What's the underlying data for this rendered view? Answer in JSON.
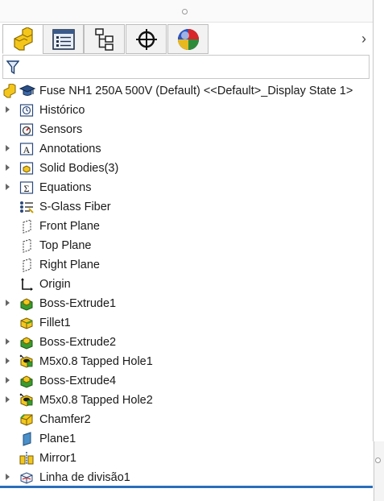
{
  "tabs": [
    {
      "name": "feature-manager",
      "icon": "part-icon",
      "active": true
    },
    {
      "name": "property-manager",
      "icon": "property-list-icon",
      "active": false
    },
    {
      "name": "configuration-manager",
      "icon": "configuration-tree-icon",
      "active": false
    },
    {
      "name": "dimxpert-manager",
      "icon": "crosshair-icon",
      "active": false
    },
    {
      "name": "display-manager",
      "icon": "appearance-sphere-icon",
      "active": false
    }
  ],
  "tab_overflow": "›",
  "filter": {
    "icon": "filter-icon"
  },
  "tree": {
    "root_label": "Fuse NH1 250A 500V (Default) <<Default>_Display State 1>",
    "items": [
      {
        "label": "Histórico",
        "icon": "history-icon",
        "expandable": true
      },
      {
        "label": "Sensors",
        "icon": "sensors-icon",
        "expandable": false
      },
      {
        "label": "Annotations",
        "icon": "annotations-icon",
        "expandable": true
      },
      {
        "label": "Solid Bodies(3)",
        "icon": "solid-bodies-icon",
        "expandable": true
      },
      {
        "label": "Equations",
        "icon": "equations-icon",
        "expandable": true
      },
      {
        "label": "S-Glass Fiber",
        "icon": "material-icon",
        "expandable": false
      },
      {
        "label": "Front Plane",
        "icon": "plane-icon",
        "expandable": false
      },
      {
        "label": "Top Plane",
        "icon": "plane-icon",
        "expandable": false
      },
      {
        "label": "Right Plane",
        "icon": "plane-icon",
        "expandable": false
      },
      {
        "label": "Origin",
        "icon": "origin-icon",
        "expandable": false
      },
      {
        "label": "Boss-Extrude1",
        "icon": "boss-extrude-icon",
        "expandable": true
      },
      {
        "label": "Fillet1",
        "icon": "fillet-icon",
        "expandable": false
      },
      {
        "label": "Boss-Extrude2",
        "icon": "boss-extrude-icon",
        "expandable": true
      },
      {
        "label": "M5x0.8 Tapped Hole1",
        "icon": "hole-wizard-icon",
        "expandable": true
      },
      {
        "label": "Boss-Extrude4",
        "icon": "boss-extrude-icon",
        "expandable": true
      },
      {
        "label": "M5x0.8 Tapped Hole2",
        "icon": "hole-wizard-icon",
        "expandable": true
      },
      {
        "label": "Chamfer2",
        "icon": "chamfer-icon",
        "expandable": false
      },
      {
        "label": "Plane1",
        "icon": "ref-plane-icon",
        "expandable": false
      },
      {
        "label": "Mirror1",
        "icon": "mirror-icon",
        "expandable": false
      },
      {
        "label": "Linha de divisão1",
        "icon": "split-line-icon",
        "expandable": true
      }
    ]
  },
  "colors": {
    "accent": "#2a6ebb",
    "feature_yellow": "#f2c81e",
    "feature_green": "#3a9b2e"
  }
}
